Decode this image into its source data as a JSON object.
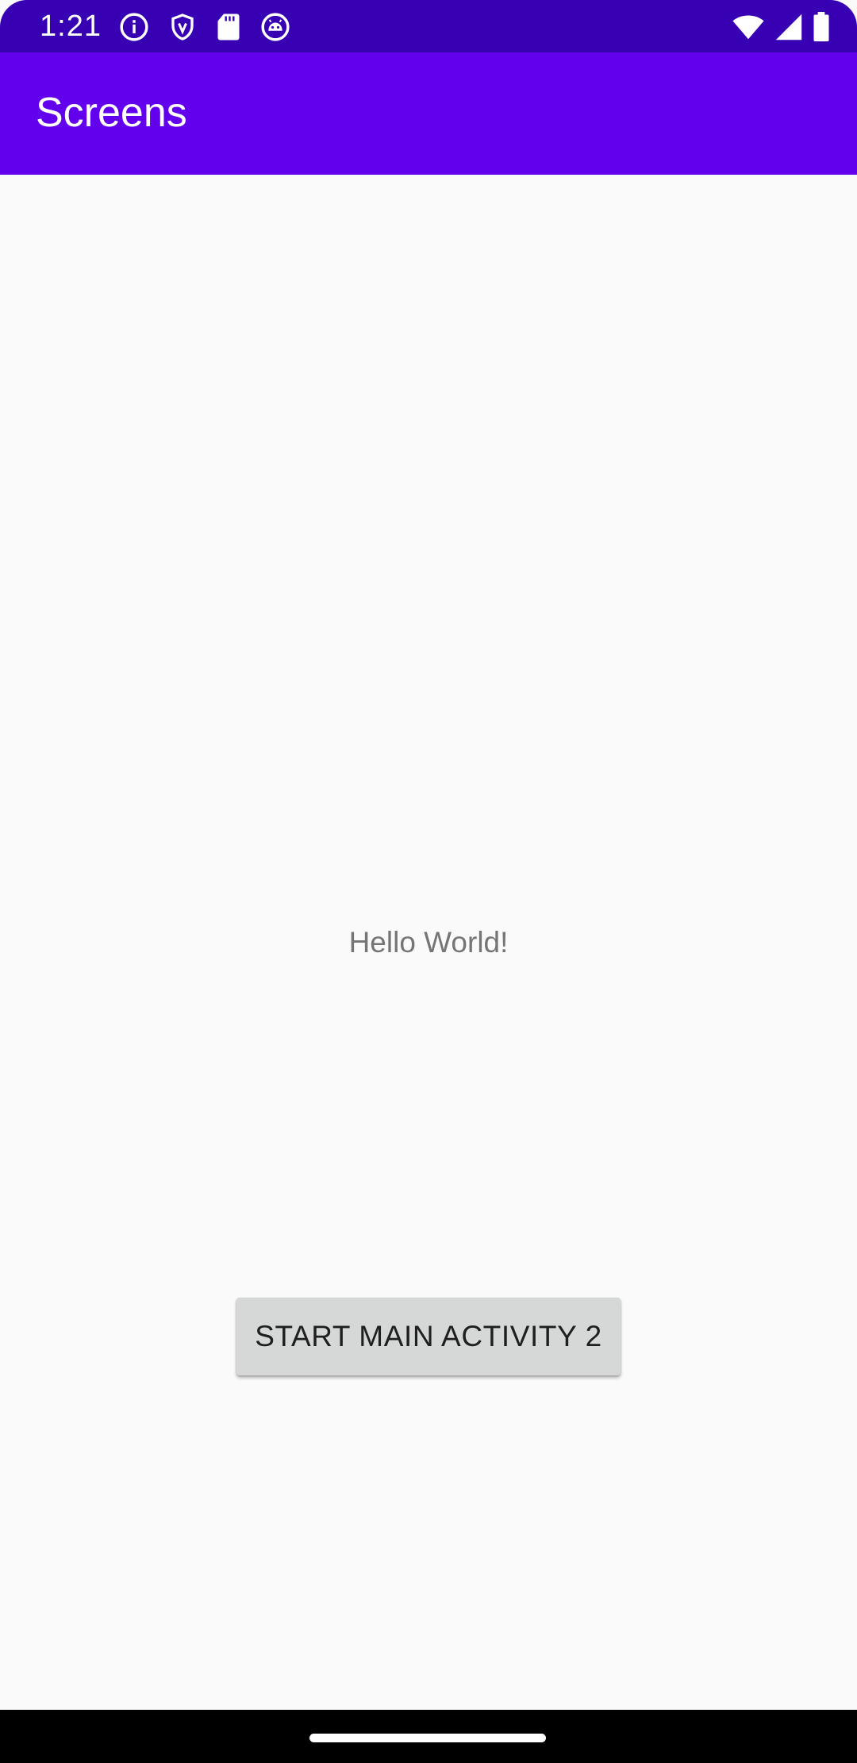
{
  "status_bar": {
    "time": "1:21",
    "left_icons": [
      "info-icon",
      "shield-icon",
      "sd-card-icon",
      "android-debug-icon"
    ],
    "right_icons": [
      "wifi-icon",
      "cellular-signal-icon",
      "battery-icon"
    ],
    "background_color": "#3700B3"
  },
  "app_bar": {
    "title": "Screens",
    "background_color": "#6200EE"
  },
  "main": {
    "hello_text": "Hello World!",
    "start_button_label": "START MAIN ACTIVITY 2"
  },
  "nav_bar": {
    "home_indicator": "home-pill"
  }
}
